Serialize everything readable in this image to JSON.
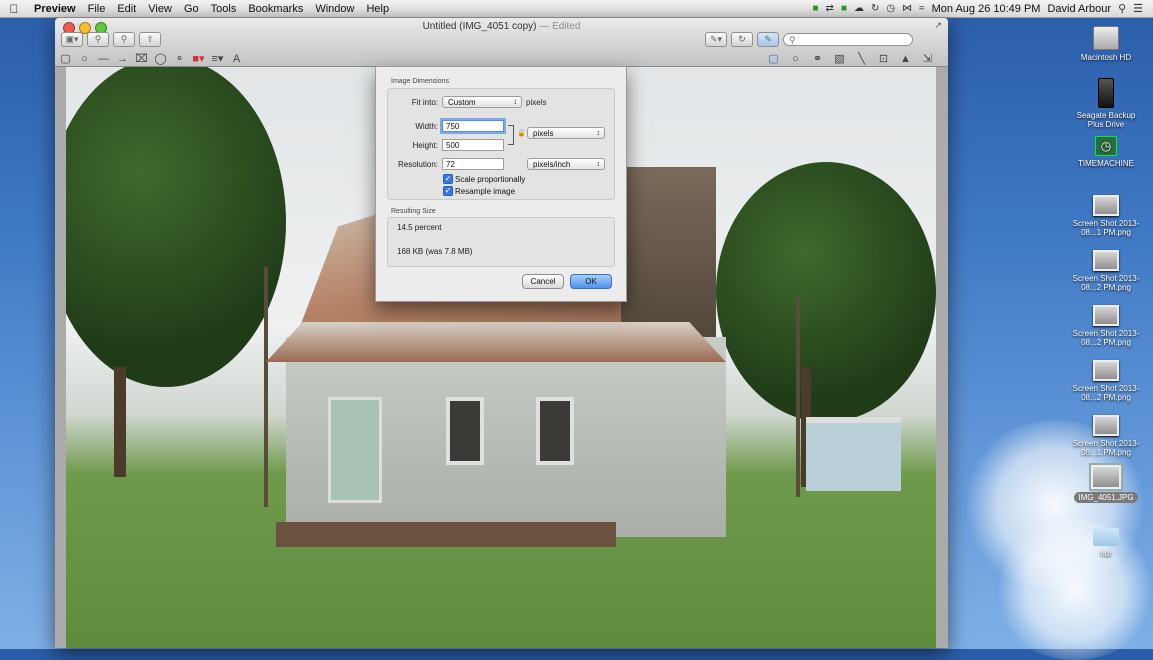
{
  "menubar": {
    "items": [
      "Preview",
      "File",
      "Edit",
      "View",
      "Go",
      "Tools",
      "Bookmarks",
      "Window",
      "Help"
    ],
    "clock": "Mon Aug 26  10:49 PM",
    "user": "David Arbour"
  },
  "window": {
    "title": "Untitled (IMG_4051 copy)",
    "title_suffix": "— Edited"
  },
  "dialog": {
    "section_dimensions": "Image Dimensions",
    "fit_into_label": "Fit into:",
    "fit_into_value": "Custom",
    "fit_into_unit": "pixels",
    "width_label": "Width:",
    "width_value": "750",
    "height_label": "Height:",
    "height_value": "500",
    "size_unit": "pixels",
    "resolution_label": "Resolution:",
    "resolution_value": "72",
    "resolution_unit": "pixels/inch",
    "scale_label": "Scale proportionally",
    "resample_label": "Resample image",
    "section_result": "Resulting Size",
    "percent": "14.5 percent",
    "size_text": "168 KB (was 7.8 MB)",
    "cancel_label": "Cancel",
    "ok_label": "OK"
  },
  "desktop_icons": [
    {
      "label": "Macintosh HD"
    },
    {
      "label": "Seagate Backup Plus Drive"
    },
    {
      "label": "TIMEMACHINE"
    },
    {
      "label": "Screen Shot 2013-08...1 PM.png"
    },
    {
      "label": "Screen Shot 2013-08...2 PM.png"
    },
    {
      "label": "Screen Shot 2013-08...2 PM.png"
    },
    {
      "label": "Screen Shot 2013-08...2 PM.png"
    },
    {
      "label": "Screen Shot 2013-08...1 PM.png"
    },
    {
      "label": "IMG_4051.JPG"
    },
    {
      "label": "hdr"
    }
  ],
  "colors": {
    "traffic_close": "#ee5a52",
    "traffic_min": "#f5bf2e",
    "traffic_max": "#5fc73c",
    "accent": "#4d93ec"
  }
}
